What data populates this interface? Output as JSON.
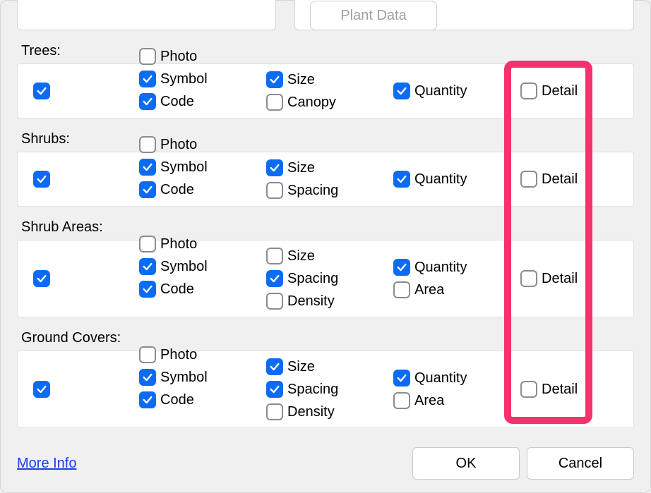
{
  "top": {
    "plant_data_button": "Plant Data"
  },
  "sections": [
    {
      "id": "trees",
      "label": "Trees:",
      "main_checked": true,
      "col_photos": [
        {
          "label": "Photo",
          "checked": false
        },
        {
          "label": "Symbol",
          "checked": true
        },
        {
          "label": "Code",
          "checked": true
        }
      ],
      "col_size": [
        {
          "label": "Size",
          "checked": true
        },
        {
          "label": "Canopy",
          "checked": false
        }
      ],
      "col_qty": [
        {
          "label": "Quantity",
          "checked": true
        }
      ],
      "col_detail": [
        {
          "label": "Detail",
          "checked": false
        }
      ]
    },
    {
      "id": "shrubs",
      "label": "Shrubs:",
      "main_checked": true,
      "col_photos": [
        {
          "label": "Photo",
          "checked": false
        },
        {
          "label": "Symbol",
          "checked": true
        },
        {
          "label": "Code",
          "checked": true
        }
      ],
      "col_size": [
        {
          "label": "Size",
          "checked": true
        },
        {
          "label": "Spacing",
          "checked": false
        }
      ],
      "col_qty": [
        {
          "label": "Quantity",
          "checked": true
        }
      ],
      "col_detail": [
        {
          "label": "Detail",
          "checked": false
        }
      ]
    },
    {
      "id": "shrub-areas",
      "label": "Shrub Areas:",
      "main_checked": true,
      "col_photos": [
        {
          "label": "Photo",
          "checked": false
        },
        {
          "label": "Symbol",
          "checked": true
        },
        {
          "label": "Code",
          "checked": true
        }
      ],
      "col_size": [
        {
          "label": "Size",
          "checked": false
        },
        {
          "label": "Spacing",
          "checked": true
        },
        {
          "label": "Density",
          "checked": false
        }
      ],
      "col_qty": [
        {
          "label": "Quantity",
          "checked": true
        },
        {
          "label": "Area",
          "checked": false
        }
      ],
      "col_detail": [
        {
          "label": "Detail",
          "checked": false
        }
      ]
    },
    {
      "id": "ground-covers",
      "label": "Ground Covers:",
      "main_checked": true,
      "col_photos": [
        {
          "label": "Photo",
          "checked": false
        },
        {
          "label": "Symbol",
          "checked": true
        },
        {
          "label": "Code",
          "checked": true
        }
      ],
      "col_size": [
        {
          "label": "Size",
          "checked": true
        },
        {
          "label": "Spacing",
          "checked": true
        },
        {
          "label": "Density",
          "checked": false
        }
      ],
      "col_qty": [
        {
          "label": "Quantity",
          "checked": true
        },
        {
          "label": "Area",
          "checked": false
        }
      ],
      "col_detail": [
        {
          "label": "Detail",
          "checked": false
        }
      ]
    }
  ],
  "footer": {
    "more_info": "More Info",
    "ok": "OK",
    "cancel": "Cancel"
  }
}
